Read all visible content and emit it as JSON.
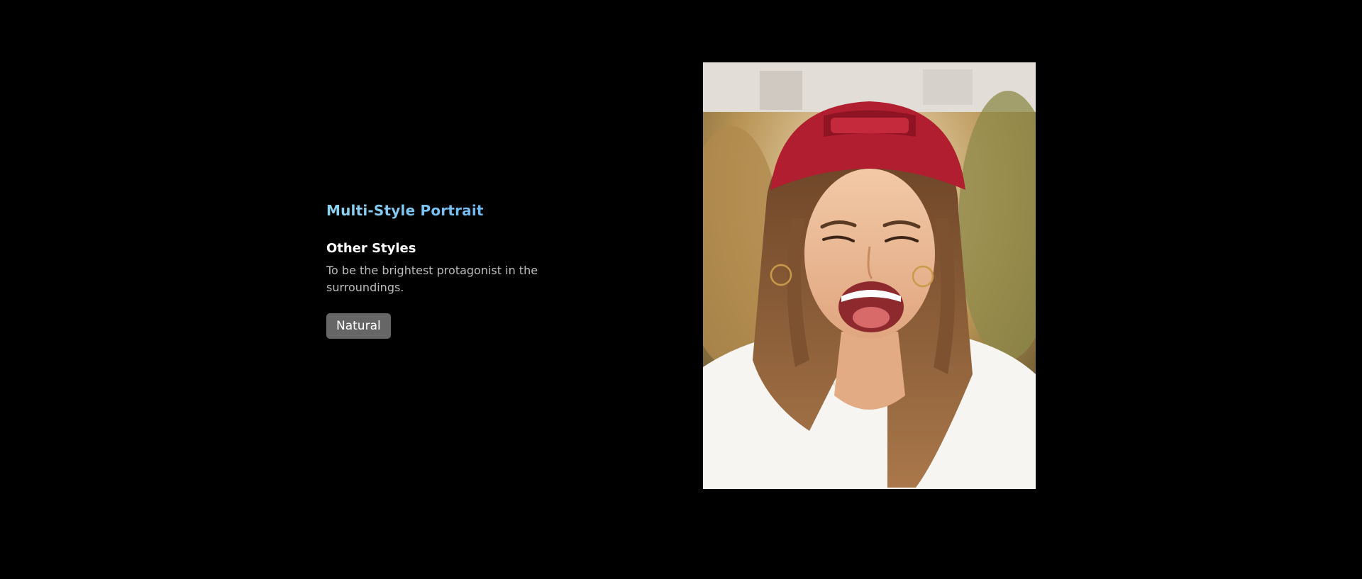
{
  "feature": {
    "title": "Multi-Style Portrait"
  },
  "style_option": {
    "heading": "Other Styles",
    "description": "To be the brightest protagonist in the surroundings.",
    "chip_label": "Natural"
  },
  "colors": {
    "background": "#000000",
    "title_gradient_start": "#8fd3f0",
    "title_gradient_end": "#5aa8f0",
    "chip_background": "#666666"
  },
  "preview_image": {
    "subject": "smiling woman in red cap and white t-shirt"
  }
}
